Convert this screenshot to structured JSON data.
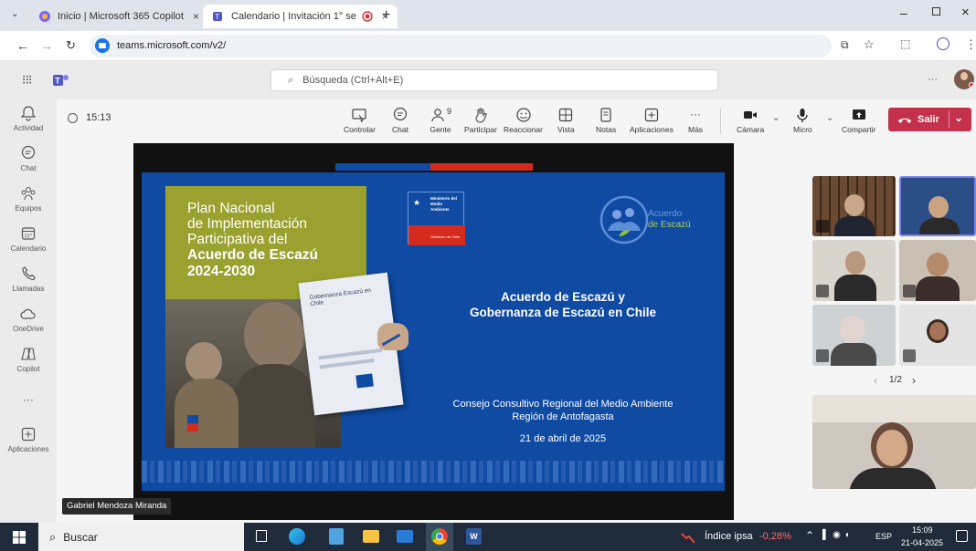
{
  "browser": {
    "tabs": [
      {
        "title": "Inicio | Microsoft 365 Copilot",
        "close": "×"
      },
      {
        "title": "Calendario | Invitación 1° se",
        "close": "×"
      }
    ],
    "new_tab": "+",
    "url": "teams.microsoft.com/v2/"
  },
  "teams": {
    "search_placeholder": "Búsqueda (Ctrl+Alt+E)",
    "more": "···"
  },
  "rail": [
    {
      "label": "Actividad",
      "icon": "bell-icon"
    },
    {
      "label": "Chat",
      "icon": "chat-icon"
    },
    {
      "label": "Equipos",
      "icon": "teams-icon"
    },
    {
      "label": "Calendario",
      "icon": "calendar-icon"
    },
    {
      "label": "Llamadas",
      "icon": "phone-icon"
    },
    {
      "label": "OneDrive",
      "icon": "cloud-icon"
    },
    {
      "label": "Copilot",
      "icon": "copilot-icon"
    },
    {
      "label": "···",
      "icon": "more-icon"
    },
    {
      "label": "Aplicaciones",
      "icon": "apps-icon"
    }
  ],
  "meeting": {
    "timer": "15:13",
    "people_count": "9",
    "toolbar": {
      "controlar": "Controlar",
      "chat": "Chat",
      "gente": "Gente",
      "participar": "Participar",
      "reaccionar": "Reaccionar",
      "vista": "Vista",
      "notas": "Notas",
      "aplicaciones": "Aplicaciones",
      "mas": "Más",
      "camara": "Cámara",
      "micro": "Micro",
      "compartir": "Compartir",
      "salir": "Salir"
    },
    "presenter_name": "Gabriel Mendoza Miranda",
    "pagination": "1/2"
  },
  "slide": {
    "cover_title": [
      "Plan Nacional",
      "de Implementación",
      "Participativa del"
    ],
    "cover_title_bold": [
      "Acuerdo de Escazú",
      "2024-2030"
    ],
    "booklet_text": "Gobernanza Escazú en Chile",
    "ministry": [
      "Ministerio del",
      "Medio",
      "Ambiente"
    ],
    "gov": "Gobierno de Chile",
    "logo_text": [
      "Acuerdo",
      "de Escazú"
    ],
    "main_title": [
      "Acuerdo de Escazú y",
      "Gobernanza de Escazú en Chile"
    ],
    "subtitle": [
      "Consejo Consultivo Regional del Medio Ambiente",
      "Región de Antofagasta"
    ],
    "date": "21 de abril de 2025",
    "colors": {
      "blue": "#0f4aa3",
      "olive": "#9aa12f",
      "red": "#d52b1e"
    }
  },
  "taskbar": {
    "search": "Buscar",
    "stock_name": "Índice ipsa",
    "stock_change": "-0,28%",
    "lang": "ESP",
    "time": "15:09",
    "date": "21-04-2025"
  }
}
